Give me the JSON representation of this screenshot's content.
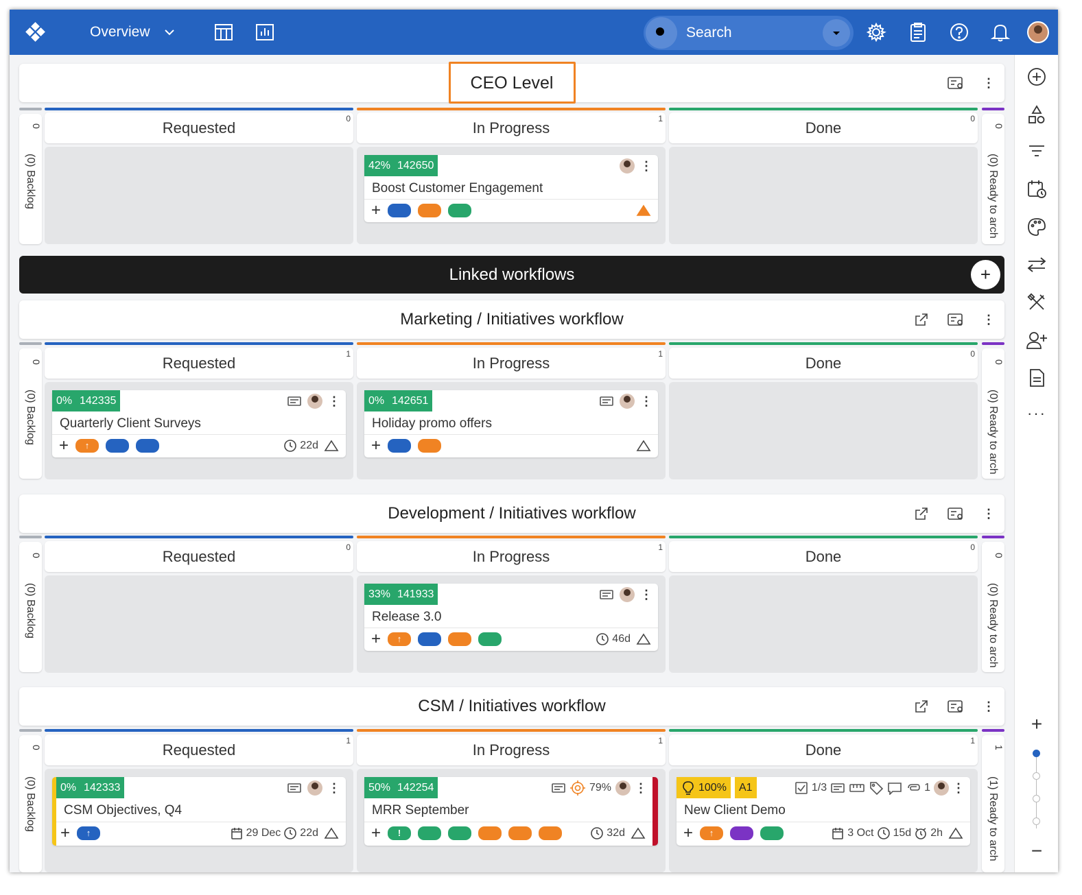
{
  "topbar": {
    "view_label": "Overview",
    "search_placeholder": "Search"
  },
  "ceo": {
    "title": "CEO Level",
    "left_count": "0",
    "left_label": "(0) Backlog",
    "right_count": "0",
    "right_label": "(0) Ready to arch",
    "columns": [
      {
        "title": "Requested",
        "count": "0"
      },
      {
        "title": "In Progress",
        "count": "1"
      },
      {
        "title": "Done",
        "count": "0"
      }
    ],
    "card": {
      "pct": "42%",
      "id": "142650",
      "name": "Boost Customer Engagement"
    }
  },
  "linked": {
    "title": "Linked workflows",
    "add": "+"
  },
  "marketing": {
    "title": "Marketing / Initiatives workflow",
    "left_count": "0",
    "left_label": "(0) Backlog",
    "right_count": "0",
    "right_label": "(0) Ready to arch",
    "columns": [
      {
        "title": "Requested",
        "count": "1"
      },
      {
        "title": "In Progress",
        "count": "1"
      },
      {
        "title": "Done",
        "count": "0"
      }
    ],
    "cards": [
      {
        "pct": "0%",
        "id": "142335",
        "name": "Quarterly Client Surveys",
        "time": "22d"
      },
      {
        "pct": "0%",
        "id": "142651",
        "name": "Holiday promo offers"
      }
    ]
  },
  "development": {
    "title": "Development / Initiatives workflow",
    "left_count": "0",
    "left_label": "(0) Backlog",
    "right_count": "0",
    "right_label": "(0) Ready to arch",
    "columns": [
      {
        "title": "Requested",
        "count": "0"
      },
      {
        "title": "In Progress",
        "count": "1"
      },
      {
        "title": "Done",
        "count": "0"
      }
    ],
    "card": {
      "pct": "33%",
      "id": "141933",
      "name": "Release 3.0",
      "time": "46d"
    }
  },
  "csm": {
    "title": "CSM / Initiatives workflow",
    "left_count": "0",
    "left_label": "(0) Backlog",
    "right_count": "1",
    "right_label": "(1) Ready to arch",
    "columns": [
      {
        "title": "Requested",
        "count": "1"
      },
      {
        "title": "In Progress",
        "count": "1"
      },
      {
        "title": "Done",
        "count": "1"
      }
    ],
    "cards": [
      {
        "pct": "0%",
        "id": "142333",
        "name": "CSM Objectives, Q4",
        "date": "29 Dec",
        "time": "22d"
      },
      {
        "pct": "50%",
        "id": "142254",
        "name": "MRR September",
        "target": "79%",
        "time": "32d"
      },
      {
        "pct": "100%",
        "id": "A1",
        "name": "New Client Demo",
        "checks": "1/3",
        "attachments": "1",
        "date": "3 Oct",
        "time": "15d",
        "alarm": "2h"
      }
    ]
  },
  "colors": {
    "blue": "#2563c0",
    "orange": "#f08323",
    "green": "#28a66b",
    "purple": "#7b33c4",
    "red": "#c0102a",
    "yellow": "#f5c518"
  }
}
